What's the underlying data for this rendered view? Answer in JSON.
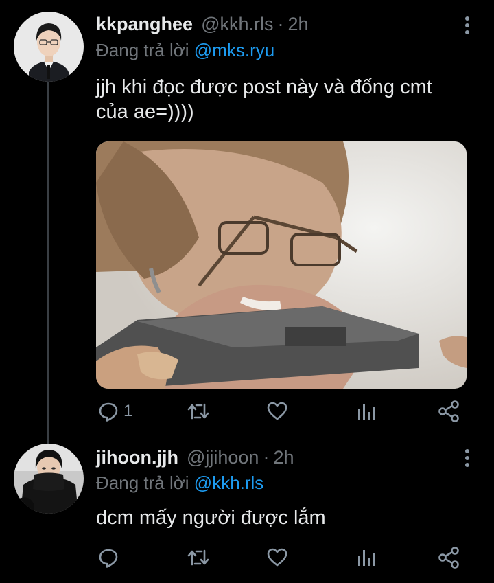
{
  "colors": {
    "background": "#000000",
    "text_primary": "#e7e9ea",
    "text_secondary": "#71767b",
    "link": "#1d9bf0",
    "icon": "#8b98a5",
    "thread_line": "#3a3f44"
  },
  "tweets": [
    {
      "display_name": "kkpanghee",
      "handle": "@kkh.rls",
      "separator": "·",
      "time": "2h",
      "reply_prefix": "Đang trả lời",
      "reply_to": "@mks.ryu",
      "text_lines": [
        "jjh khi đọc được post này và đống cmt",
        "của ae=))))"
      ],
      "has_media": true,
      "media_description_icon": "photo",
      "actions": {
        "reply_icon": "reply-icon",
        "reply_count": "1",
        "retweet_icon": "retweet-icon",
        "like_icon": "heart-icon",
        "analytics_icon": "analytics-icon",
        "share_icon": "share-icon"
      }
    },
    {
      "display_name": "jihoon.jjh",
      "handle": "@jjihoon",
      "separator": "·",
      "time": "2h",
      "reply_prefix": "Đang trả lời",
      "reply_to": "@kkh.rls",
      "text_lines": [
        "dcm mấy người được lắm"
      ],
      "has_media": false,
      "actions": {
        "reply_icon": "reply-icon",
        "reply_count": "",
        "retweet_icon": "retweet-icon",
        "like_icon": "heart-icon",
        "analytics_icon": "analytics-icon",
        "share_icon": "share-icon"
      }
    }
  ]
}
